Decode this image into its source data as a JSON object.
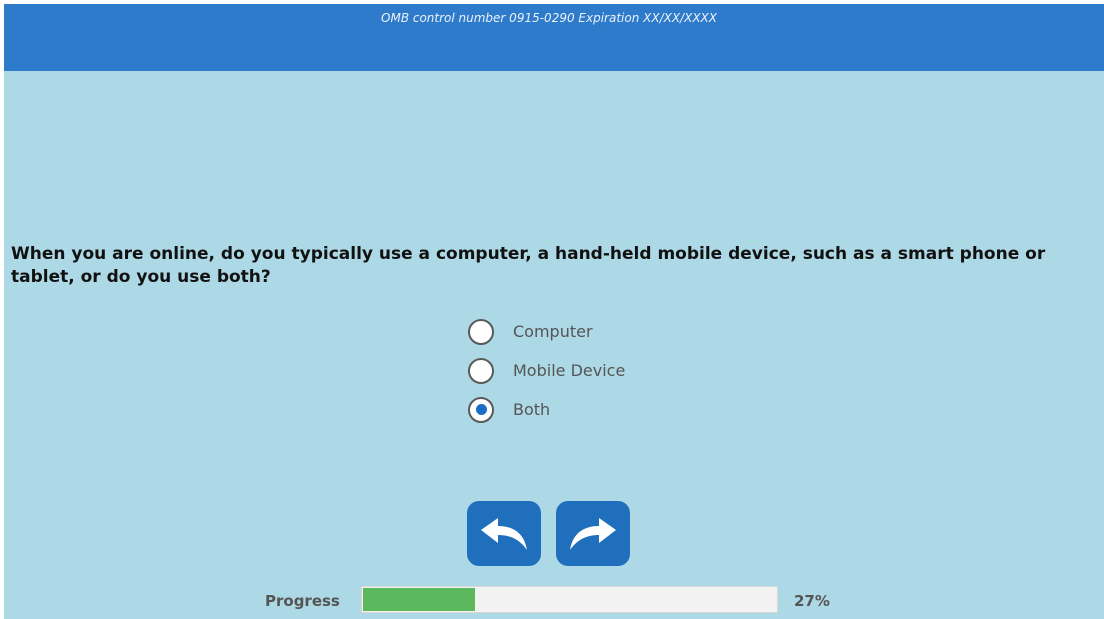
{
  "header": {
    "omb_text": "OMB control number 0915-0290 Expiration XX/XX/XXXX",
    "color": "#2f7bcb"
  },
  "page": {
    "background": "#add8e6"
  },
  "question": {
    "text": "When you are online, do you typically use a computer, a hand-held mobile device, such as a smart phone or tablet, or do you use both?"
  },
  "options": [
    {
      "label": "Computer",
      "selected": false
    },
    {
      "label": "Mobile Device",
      "selected": false
    },
    {
      "label": "Both",
      "selected": true
    }
  ],
  "navigation": {
    "back_icon": "back-arrow-icon",
    "next_icon": "forward-arrow-icon",
    "button_color": "#1f6fbd"
  },
  "progress": {
    "label": "Progress",
    "percent_text": "27%",
    "value": 0.27,
    "fill_color": "#5cb85c"
  }
}
